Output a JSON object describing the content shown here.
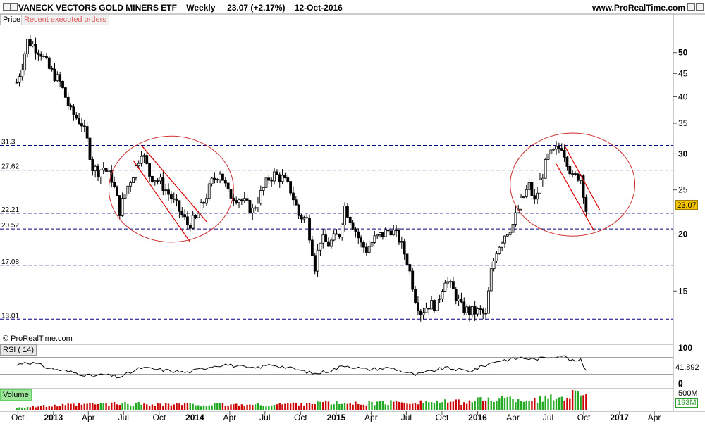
{
  "header": {
    "title": "VANECK VECTORS GOLD MINERS ETF",
    "timeframe": "Weekly",
    "quote": "23.07 (+2.17%)",
    "date": "12-Oct-2016",
    "url": "www.ProRealTime.com"
  },
  "tags": {
    "price": "Price",
    "orders": "Recent executed orders",
    "rsi": "RSI ( 14)",
    "volume": "Volume"
  },
  "copyright": "© ProRealTime.com",
  "last_price": "23.07",
  "rsi_last": "41.892",
  "vol_last": "193M",
  "colors": {
    "up": "#ffffff",
    "down": "#000000",
    "level_line": "#000080",
    "trend_line": "#e00000",
    "circle": "#d03030",
    "vol_up": "#22aa22",
    "vol_down": "#cc0000",
    "last_price_bg": "#f5c400"
  },
  "chart_data": [
    {
      "type": "candlestick",
      "title": "VANECK VECTORS GOLD MINERS ETF",
      "timeframe": "Weekly",
      "scale": "log",
      "ylim": [
        11.5,
        58
      ],
      "y_ticks": [
        15,
        20,
        25,
        30,
        35,
        40,
        45,
        50
      ],
      "x_ticks": [
        "Oct",
        "2013",
        "Apr",
        "Jul",
        "Oct",
        "2014",
        "Apr",
        "Jul",
        "Oct",
        "2015",
        "Apr",
        "Jul",
        "Oct",
        "2016",
        "Apr",
        "Jul",
        "Oct",
        "2017",
        "Apr"
      ],
      "levels": [
        31.3,
        27.62,
        22.21,
        20.52,
        17.08,
        13.01
      ],
      "level_labels": [
        "31.3",
        "27.62",
        "22.21",
        "20.52",
        "17.08",
        "13.01"
      ],
      "last": 23.07,
      "close_path": [
        [
          "2012-09-28",
          43
        ],
        [
          "2012-10-12",
          47
        ],
        [
          "2012-10-26",
          53
        ],
        [
          "2012-11-09",
          52
        ],
        [
          "2012-11-30",
          50
        ],
        [
          "2012-12-21",
          46
        ],
        [
          "2013-01-18",
          43
        ],
        [
          "2013-02-15",
          37
        ],
        [
          "2013-03-15",
          35
        ],
        [
          "2013-03-29",
          32
        ],
        [
          "2013-04-12",
          28
        ],
        [
          "2013-04-26",
          27.5
        ],
        [
          "2013-05-10",
          28
        ],
        [
          "2013-05-31",
          26.5
        ],
        [
          "2013-06-21",
          22.5
        ],
        [
          "2013-07-12",
          25.5
        ],
        [
          "2013-08-02",
          28
        ],
        [
          "2013-08-16",
          30.5
        ],
        [
          "2013-09-06",
          27
        ],
        [
          "2013-10-04",
          26
        ],
        [
          "2013-11-01",
          24
        ],
        [
          "2013-11-22",
          22.5
        ],
        [
          "2013-12-13",
          21
        ],
        [
          "2014-01-03",
          21.5
        ],
        [
          "2014-01-24",
          23.5
        ],
        [
          "2014-02-14",
          26
        ],
        [
          "2014-03-07",
          27.5
        ],
        [
          "2014-03-28",
          24.5
        ],
        [
          "2014-04-25",
          24
        ],
        [
          "2014-05-30",
          22.5
        ],
        [
          "2014-06-20",
          24.5
        ],
        [
          "2014-07-11",
          26.5
        ],
        [
          "2014-07-25",
          27
        ],
        [
          "2014-08-15",
          26.5
        ],
        [
          "2014-09-05",
          25
        ],
        [
          "2014-09-26",
          22
        ],
        [
          "2014-10-17",
          21.5
        ],
        [
          "2014-11-07",
          17
        ],
        [
          "2014-11-21",
          19.5
        ],
        [
          "2014-12-12",
          19
        ],
        [
          "2015-01-09",
          20
        ],
        [
          "2015-01-23",
          23
        ],
        [
          "2015-02-13",
          21
        ],
        [
          "2015-03-06",
          19
        ],
        [
          "2015-03-20",
          18.5
        ],
        [
          "2015-04-10",
          19.5
        ],
        [
          "2015-05-01",
          20
        ],
        [
          "2015-05-22",
          20.5
        ],
        [
          "2015-06-12",
          19.5
        ],
        [
          "2015-07-03",
          17.5
        ],
        [
          "2015-07-24",
          14.5
        ],
        [
          "2015-08-07",
          13.5
        ],
        [
          "2015-08-28",
          14
        ],
        [
          "2015-09-18",
          14
        ],
        [
          "2015-10-09",
          16
        ],
        [
          "2015-10-30",
          15
        ],
        [
          "2015-11-20",
          13.8
        ],
        [
          "2015-12-11",
          13.5
        ],
        [
          "2016-01-08",
          13.5
        ],
        [
          "2016-01-22",
          13.2
        ],
        [
          "2016-02-05",
          16.5
        ],
        [
          "2016-02-19",
          18.5
        ],
        [
          "2016-03-11",
          20
        ],
        [
          "2016-04-01",
          21
        ],
        [
          "2016-04-22",
          23.5
        ],
        [
          "2016-05-13",
          25.5
        ],
        [
          "2016-05-27",
          23.5
        ],
        [
          "2016-06-10",
          26
        ],
        [
          "2016-07-01",
          29.5
        ],
        [
          "2016-07-22",
          30.5
        ],
        [
          "2016-08-05",
          31.3
        ],
        [
          "2016-08-19",
          29
        ],
        [
          "2016-09-02",
          26.5
        ],
        [
          "2016-09-23",
          27
        ],
        [
          "2016-10-07",
          22.6
        ],
        [
          "2016-10-12",
          23.07
        ]
      ],
      "trend_lines": [
        [
          [
            "2013-08-16",
            31.3
          ],
          [
            "2014-01-31",
            21.3
          ]
        ],
        [
          [
            "2013-07-26",
            29
          ],
          [
            "2013-12-20",
            19.2
          ]
        ],
        [
          [
            "2016-08-12",
            31.3
          ],
          [
            "2016-11-11",
            22.6
          ]
        ],
        [
          [
            "2016-07-22",
            28.5
          ],
          [
            "2016-10-28",
            20.3
          ]
        ]
      ],
      "circles": [
        {
          "center": [
            "2013-11-01",
            24.5
          ],
          "x_radius_weeks": 23,
          "y_top": 32.8,
          "y_bottom": 19.2
        },
        {
          "center": [
            "2016-09-02",
            25.2
          ],
          "x_radius_weeks": 23,
          "y_top": 33.3,
          "y_bottom": 19.8
        }
      ]
    },
    {
      "type": "line",
      "title": "RSI ( 14)",
      "ylim": [
        0,
        100
      ],
      "y_ticks": [
        0,
        100
      ],
      "levels": [
        30,
        70
      ],
      "last": 41.892,
      "path": [
        [
          "2012-09-28",
          52
        ],
        [
          "2012-10-19",
          60
        ],
        [
          "2012-11-16",
          56
        ],
        [
          "2012-12-21",
          45
        ],
        [
          "2013-02-15",
          36
        ],
        [
          "2013-04-12",
          26
        ],
        [
          "2013-05-10",
          30
        ],
        [
          "2013-06-21",
          24
        ],
        [
          "2013-08-16",
          46
        ],
        [
          "2013-10-18",
          40
        ],
        [
          "2013-12-13",
          35
        ],
        [
          "2014-02-14",
          50
        ],
        [
          "2014-03-21",
          54
        ],
        [
          "2014-05-30",
          44
        ],
        [
          "2014-07-18",
          54
        ],
        [
          "2014-09-05",
          45
        ],
        [
          "2014-11-07",
          32
        ],
        [
          "2014-12-19",
          40
        ],
        [
          "2015-01-23",
          52
        ],
        [
          "2015-03-20",
          42
        ],
        [
          "2015-05-22",
          46
        ],
        [
          "2015-07-24",
          29
        ],
        [
          "2015-10-09",
          46
        ],
        [
          "2015-12-11",
          38
        ],
        [
          "2016-02-19",
          62
        ],
        [
          "2016-04-22",
          70
        ],
        [
          "2016-05-27",
          66
        ],
        [
          "2016-08-05",
          76
        ],
        [
          "2016-09-02",
          62
        ],
        [
          "2016-09-23",
          64
        ],
        [
          "2016-10-07",
          40
        ],
        [
          "2016-10-12",
          41.892
        ]
      ]
    },
    {
      "type": "bar",
      "title": "Volume",
      "ylim": [
        0,
        500000000
      ],
      "y_ticks_labels": [
        "500M",
        "0"
      ],
      "last": "193M",
      "segments": [
        [
          "2012-09-28",
          60000000
        ],
        [
          "2013-04-12",
          140000000
        ],
        [
          "2013-07-12",
          150000000
        ],
        [
          "2014-01-10",
          130000000
        ],
        [
          "2014-07-11",
          120000000
        ],
        [
          "2014-11-07",
          180000000
        ],
        [
          "2015-02-06",
          150000000
        ],
        [
          "2015-07-24",
          200000000
        ],
        [
          "2015-11-20",
          190000000
        ],
        [
          "2016-02-19",
          280000000
        ],
        [
          "2016-05-27",
          250000000
        ],
        [
          "2016-08-05",
          320000000
        ],
        [
          "2016-10-07",
          500000000
        ],
        [
          "2016-10-12",
          193000000
        ]
      ]
    }
  ]
}
